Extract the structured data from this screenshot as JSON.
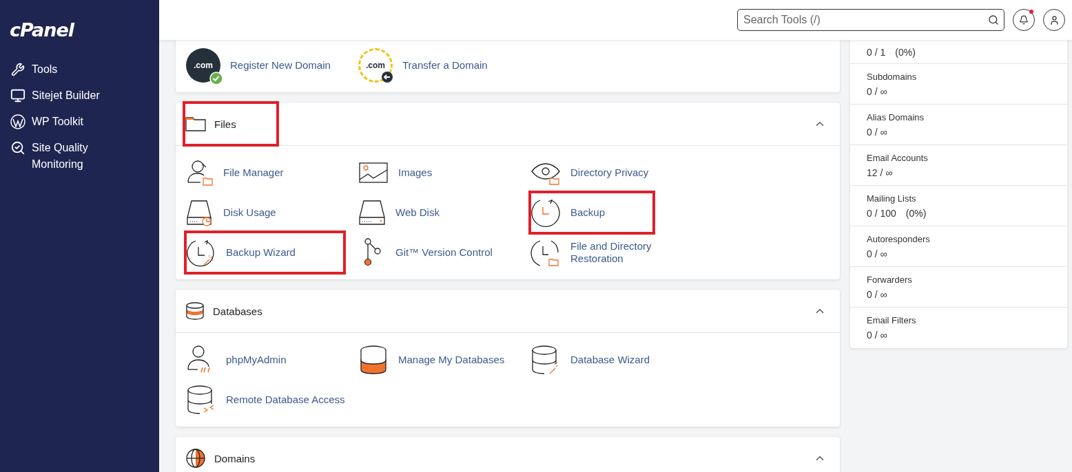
{
  "sidebar": {
    "logo": "cPanel",
    "items": [
      {
        "label": "Tools"
      },
      {
        "label": "Sitejet Builder"
      },
      {
        "label": "WP Toolkit"
      },
      {
        "label": "Site Quality Monitoring"
      }
    ]
  },
  "header": {
    "search": {
      "placeholder": "Search Tools (/)"
    },
    "notification_unread": true
  },
  "sections": [
    {
      "items": [
        {
          "label": "Register New Domain",
          "icon_text": ".com",
          "highlighted": false
        },
        {
          "label": "Transfer a Domain",
          "icon_text": ".com",
          "highlighted": false
        }
      ]
    },
    {
      "title": "Files",
      "expanded": true,
      "highlighted": true,
      "items": [
        {
          "label": "File Manager",
          "highlighted": false
        },
        {
          "label": "Images",
          "highlighted": false
        },
        {
          "label": "Directory Privacy",
          "highlighted": false
        },
        {
          "label": "Disk Usage",
          "highlighted": false
        },
        {
          "label": "Web Disk",
          "highlighted": false
        },
        {
          "label": "Backup",
          "highlighted": true
        },
        {
          "label": "Backup Wizard",
          "highlighted": true
        },
        {
          "label": "Git™ Version Control",
          "highlighted": false
        },
        {
          "label": "File and Directory Restoration",
          "highlighted": false
        }
      ]
    },
    {
      "title": "Databases",
      "expanded": true,
      "highlighted": false,
      "items": [
        {
          "label": "phpMyAdmin",
          "highlighted": false
        },
        {
          "label": "Manage My Databases",
          "highlighted": false
        },
        {
          "label": "Database Wizard",
          "highlighted": false
        },
        {
          "label": "Remote Database Access",
          "highlighted": false
        }
      ]
    },
    {
      "title": "Domains",
      "expanded": true,
      "highlighted": false
    }
  ],
  "stats": [
    {
      "value": "0 / 1",
      "percent": "(0%)"
    },
    {
      "label": "Subdomains",
      "value": "0 / ∞"
    },
    {
      "label": "Alias Domains",
      "value": "0 / ∞"
    },
    {
      "label": "Email Accounts",
      "value": "12 / ∞"
    },
    {
      "label": "Mailing Lists",
      "value": "0 / 100",
      "percent": "(0%)"
    },
    {
      "label": "Autoresponders",
      "value": "0 / ∞"
    },
    {
      "label": "Forwarders",
      "value": "0 / ∞"
    },
    {
      "label": "Email Filters",
      "value": "0 / ∞"
    }
  ]
}
